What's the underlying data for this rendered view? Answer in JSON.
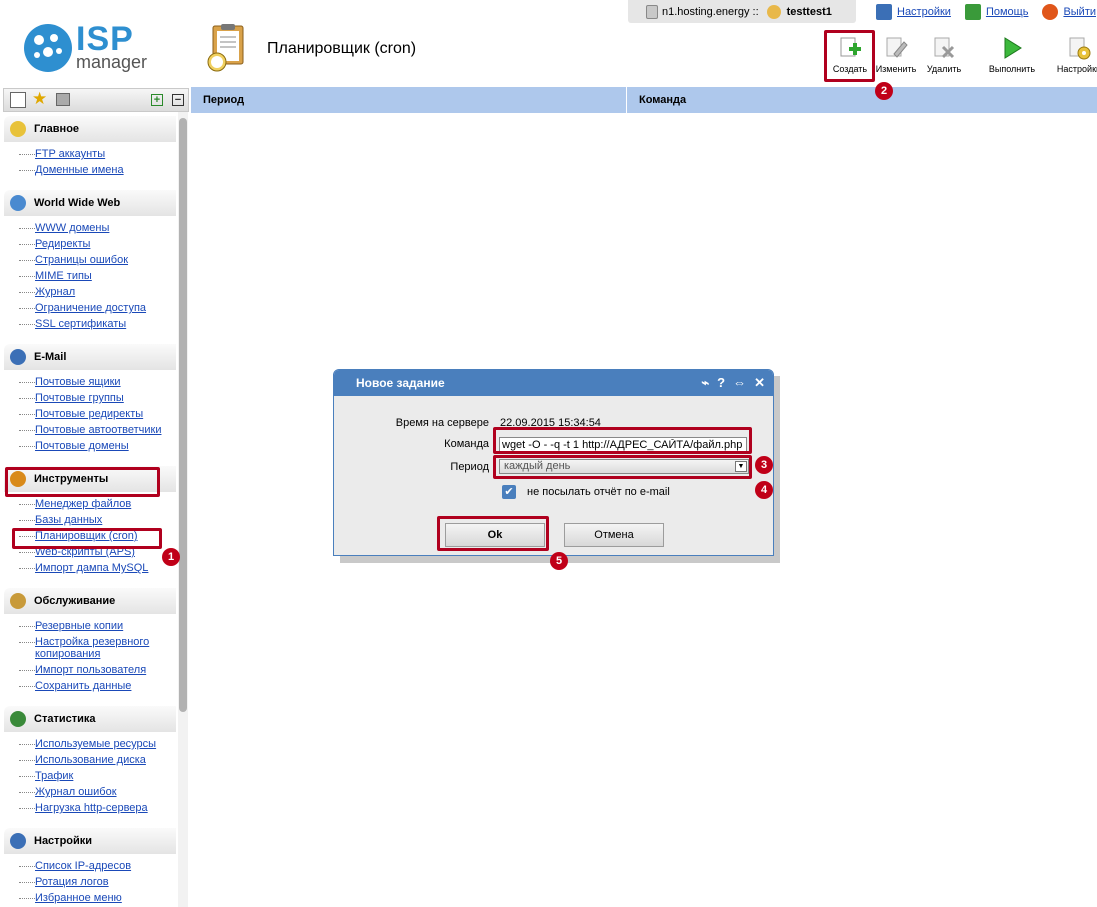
{
  "topbar": {
    "host": "n1.hosting.energy ::",
    "username": "testtest1",
    "links": [
      {
        "label": "Настройки",
        "icon": "settings-monitor-icon"
      },
      {
        "label": "Помощь",
        "icon": "help-icon"
      },
      {
        "label": "Выйти",
        "icon": "power-icon"
      }
    ]
  },
  "logo": {
    "brand": "ISP",
    "product": "manager"
  },
  "page": {
    "title": "Планировщик (cron)"
  },
  "toolbar": {
    "create": "Создать",
    "edit": "Изменить",
    "delete": "Удалить",
    "run": "Выполнить",
    "settings": "Настройки"
  },
  "list": {
    "columns": [
      "Период",
      "Команда"
    ]
  },
  "sidebar": {
    "groups": [
      {
        "title": "Главное",
        "items": [
          "FTP аккаунты",
          "Доменные имена"
        ]
      },
      {
        "title": "World Wide Web",
        "items": [
          "WWW домены",
          "Редиректы",
          "Страницы ошибок",
          "MIME типы",
          "Журнал",
          "Ограничение доступа",
          "SSL сертификаты"
        ]
      },
      {
        "title": "E-Mail",
        "items": [
          "Почтовые ящики",
          "Почтовые группы",
          "Почтовые редиректы",
          "Почтовые автоответчики",
          "Почтовые домены"
        ]
      },
      {
        "title": "Инструменты",
        "items": [
          "Менеджер файлов",
          "Базы данных",
          "Планировщик (cron)",
          "Web-скрипты (APS)",
          "Импорт дампа MySQL"
        ]
      },
      {
        "title": "Обслуживание",
        "items": [
          "Резервные копии",
          "Настройка резервного копирования",
          "Импорт пользователя",
          "Сохранить данные"
        ]
      },
      {
        "title": "Статистика",
        "items": [
          "Используемые ресурсы",
          "Использование диска",
          "Трафик",
          "Журнал ошибок",
          "Нагрузка http-сервера"
        ]
      },
      {
        "title": "Настройки",
        "items": [
          "Список IP-адресов",
          "Ротация логов",
          "Избранное меню"
        ]
      }
    ]
  },
  "dialog": {
    "title": "Новое задание",
    "server_time_label": "Время на сервере",
    "server_time": "22.09.2015 15:34:54",
    "command_label": "Команда",
    "command_value": "wget -O - -q -t 1 http://АДРЕС_САЙТА/файл.php",
    "period_label": "Период",
    "period_value": "каждый день",
    "no_email_label": "не посылать отчёт по e-mail",
    "ok": "Ok",
    "cancel": "Отмена"
  },
  "annotations": [
    "1",
    "2",
    "3",
    "4",
    "5"
  ],
  "colors": {
    "accent": "#4a7fbd",
    "highlight": "#b0001e",
    "list_header": "#aec8ec"
  }
}
